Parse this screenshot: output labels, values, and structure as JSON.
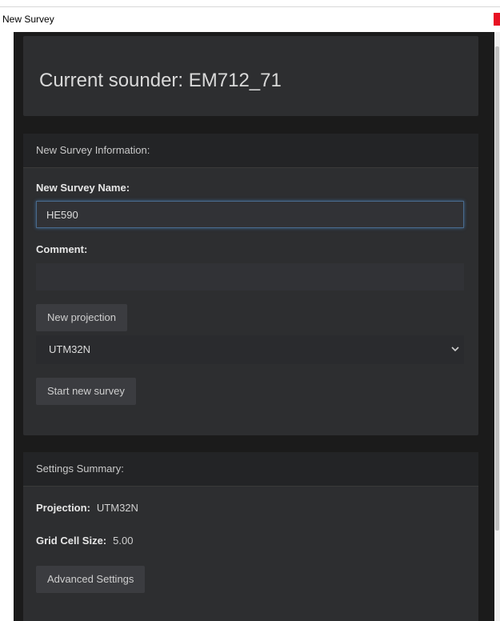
{
  "window": {
    "title": "New Survey"
  },
  "sounder": {
    "heading": "Current sounder: EM712_71"
  },
  "info": {
    "header": "New Survey Information:",
    "name_label": "New Survey Name:",
    "name_value": "HE590",
    "comment_label": "Comment:",
    "comment_value": "",
    "new_projection_button": "New projection",
    "projection_select": "UTM32N",
    "start_button": "Start new survey"
  },
  "summary": {
    "header": "Settings Summary:",
    "projection_key": "Projection:",
    "projection_value": "UTM32N",
    "grid_key": "Grid Cell Size:",
    "grid_value": "5.00",
    "advanced_button": "Advanced Settings"
  },
  "colors": {
    "background": "#1b1b1b",
    "card": "#2d2e30",
    "card_header": "#232426",
    "focus_border": "#4a6a8c",
    "close_button": "#e81123"
  }
}
